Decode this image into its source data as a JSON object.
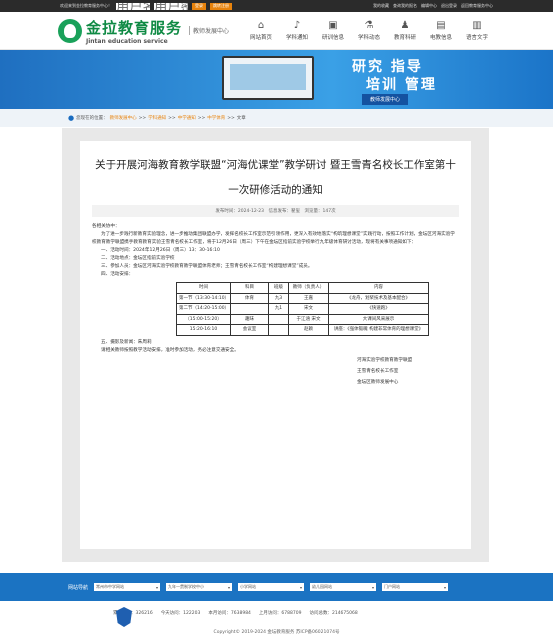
{
  "topbar": {
    "welcome": "欢迎来到金拉教育服务中心！",
    "account_placeholder": "用户名",
    "password_placeholder": "用户密码",
    "login": "登录",
    "register": "跳转注册",
    "links": [
      "我的收藏",
      "查询我的报名",
      "编辑中心",
      "退出登录",
      "返回教育服务中心"
    ]
  },
  "header": {
    "logo_cn": "金拉教育服务",
    "logo_en": "Jintan education service",
    "subtitle": "教师发展中心"
  },
  "nav": [
    {
      "label": "网站首页",
      "icon": "home-icon",
      "glyph": "⌂"
    },
    {
      "label": "学科通知",
      "icon": "megaphone-icon",
      "glyph": "♪"
    },
    {
      "label": "研训信息",
      "icon": "tv-icon",
      "glyph": "▣"
    },
    {
      "label": "学科动态",
      "icon": "flask-icon",
      "glyph": "⚗"
    },
    {
      "label": "教育科研",
      "icon": "microscope-icon",
      "glyph": "♟"
    },
    {
      "label": "电教信息",
      "icon": "computer-icon",
      "glyph": "▤"
    },
    {
      "label": "语言文字",
      "icon": "book-icon",
      "glyph": "▥"
    }
  ],
  "banner": {
    "line1": "研究 指导",
    "line2": "培训 管理",
    "tag": "教师发展中心"
  },
  "breadcrumb": {
    "prefix": "您现在的位置：",
    "items": [
      "教师发展中心",
      "学科通知",
      "中学通知",
      "中学体育"
    ],
    "current": "文章"
  },
  "article": {
    "title": "关于开展河海教育教学联盟“河海优课堂”教学研讨 暨王雪青名校长工作室第十一次研修活动的通知",
    "meta": "发布时间：2024-12-23　信息发布：翟玺　浏览量：147次",
    "greeting": "各相关协中：",
    "intro": "为了进一步践行新教育实验理念，进一步推动集团联盟办学，发挥名校长工作室示范引领作用，更深入有效地落实“构筑理想课堂”实践行动，按照工作计划，金坛区河海实验学校教育教学联盟携手教育教育实验王雪青名校长工作室，将于12月26日（周三）下午在金坛区指前实验学校举行九年级体育研讨活动，现将有关事项通知如下：",
    "items": [
      "一、活动时间：2024年12月26日（周三）13：30-16:10",
      "二、活动地点：金坛区指前实验学校",
      "三、参加人员：金坛区河海实验学校教育教学联盟体育老师；王雪青名校长工作室“构建理想课堂”成员。",
      "四、活动安排："
    ],
    "table": {
      "headers": [
        "时间",
        "科目",
        "班级",
        "教师（负责人）",
        "内容"
      ],
      "rows": [
        [
          "第一节（13:30-14:10）",
          "体育",
          "九3",
          "王嘉",
          "《龙舟，划桨技术及基本配合》"
        ],
        [
          "第二节（14:20-15:00）",
          "",
          "九1",
          "宋文",
          "《快速跑》"
        ],
        [
          "（15:00-15:20）",
          "趣味",
          "",
          "于江涵 宋文",
          "大课间风采展示"
        ],
        [
          "15:20-16:10",
          "会议室",
          "",
          "赵颖",
          "讲座：《强体锻魄 构建非常体育的理想课堂》"
        ]
      ]
    },
    "after": [
      "五、摄影及新闻：朱周莉",
      "请相关教师按照教学活动安排，准时参加活动，务必注意交通安全。"
    ],
    "signature": [
      "河海实验学校教育教学联盟",
      "王雪青名校长工作室",
      "金坛区教师发展中心"
    ]
  },
  "footer": {
    "label": "网站导航",
    "selects": [
      "常州市中学网站",
      "九年一贯制学校中小",
      "小学网站",
      "幼儿园网站",
      "门户网站"
    ],
    "stats": [
      "累访总数：326216",
      "今天访问：122203",
      "本月访问：7638984",
      "上月访问：6788709",
      "访问总数：214675068"
    ],
    "copyright": "Copyright© 2019-2024 金坛教育服务 苏ICP备06021074号"
  }
}
